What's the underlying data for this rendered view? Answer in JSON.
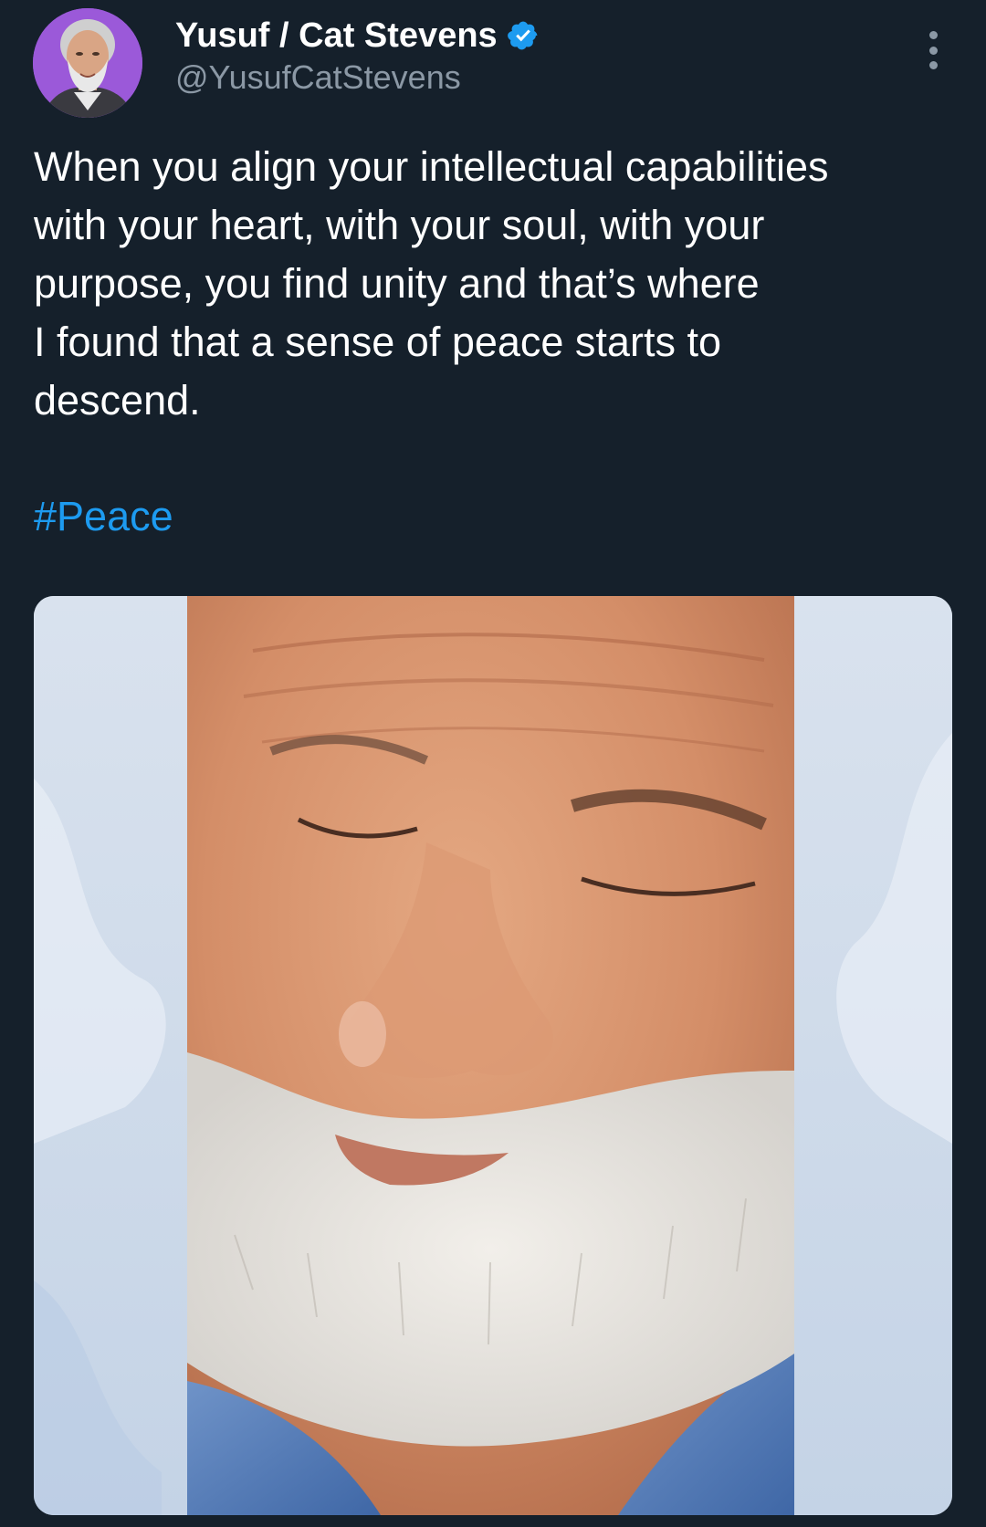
{
  "author": {
    "display_name": "Yusuf / Cat Stevens",
    "handle": "@YusufCatStevens",
    "verified": true,
    "avatar_icon": "avatar-portrait",
    "avatar_bg": "#9b59d9"
  },
  "tweet": {
    "text": "When you align your intellectual capabilities\nwith your heart, with your soul, with your\npurpose, you find unity and that’s where\nI found that a sense of peace starts to\ndescend.",
    "hashtag": "#Peace"
  },
  "icons": {
    "verified": "verified-badge-icon",
    "more": "more-options-icon"
  },
  "colors": {
    "background": "#15202b",
    "text": "#ffffff",
    "secondary_text": "#8b98a5",
    "link": "#1d9bf0",
    "verified_badge": "#1d9bf0"
  }
}
